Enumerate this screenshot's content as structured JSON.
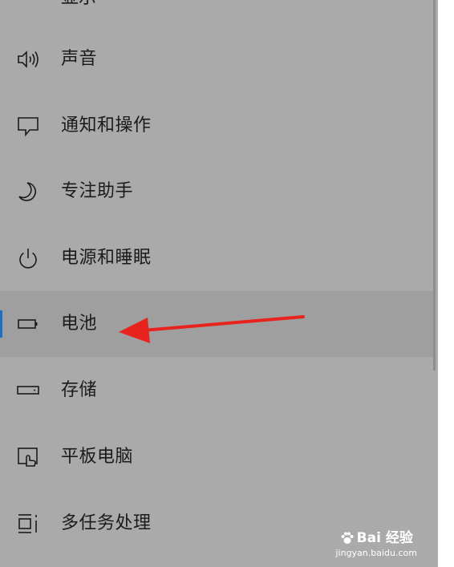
{
  "settings_nav": {
    "partial_top_label": "显示",
    "items": [
      {
        "label": "声音",
        "icon": "speaker-icon"
      },
      {
        "label": "通知和操作",
        "icon": "notification-icon"
      },
      {
        "label": "专注助手",
        "icon": "moon-icon"
      },
      {
        "label": "电源和睡眠",
        "icon": "power-icon"
      },
      {
        "label": "电池",
        "icon": "battery-icon",
        "selected": true
      },
      {
        "label": "存储",
        "icon": "storage-icon"
      },
      {
        "label": "平板电脑",
        "icon": "tablet-icon"
      },
      {
        "label": "多任务处理",
        "icon": "multitasking-icon"
      }
    ]
  },
  "annotation": {
    "arrow_color": "#e8231d",
    "points_to": "电池"
  },
  "colors": {
    "panel": "#aaaaaa",
    "selected_row": "#9f9f9f",
    "selection_indicator": "#1a6fc6"
  },
  "watermark": {
    "brand": "Bai 经验",
    "url": "jingyan.baidu.com"
  }
}
